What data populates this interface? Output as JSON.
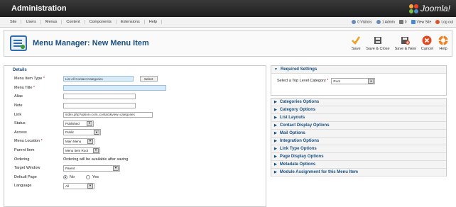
{
  "header": {
    "title": "Administration",
    "logo_text": "Joomla!"
  },
  "menu": [
    "Site",
    "Users",
    "Menus",
    "Content",
    "Components",
    "Extensions",
    "Help"
  ],
  "status": {
    "visitors": "0 Visitors",
    "admin": "1 Admin",
    "messages": "0",
    "view_site": "View Site",
    "logout": "Log out"
  },
  "page": {
    "title": "Menu Manager: New Menu Item"
  },
  "toolbar": {
    "save": "Save",
    "save_close": "Save & Close",
    "save_new": "Save & New",
    "cancel": "Cancel",
    "help": "Help"
  },
  "details": {
    "legend": "Details",
    "menu_item_type_label": "Menu Item Type",
    "menu_item_type_value": "List All Contact Categories",
    "select_button": "Select",
    "menu_title_label": "Menu Title",
    "alias_label": "Alias",
    "note_label": "Note",
    "link_label": "Link",
    "link_value": "index.php?option=com_contact&view=categories",
    "status_label": "Status",
    "status_value": "Published",
    "access_label": "Access",
    "access_value": "Public",
    "menu_location_label": "Menu Location",
    "menu_location_value": "Main Menu",
    "parent_item_label": "Parent Item",
    "parent_item_value": "Menu Item Root",
    "ordering_label": "Ordering",
    "ordering_value": "Ordering will be available after saving",
    "target_window_label": "Target Window",
    "target_window_value": "Parent",
    "default_page_label": "Default Page",
    "default_no": "No",
    "default_yes": "Yes",
    "language_label": "Language",
    "language_value": "All",
    "required_marker": "*"
  },
  "required_settings": {
    "title": "Required Settings",
    "category_label": "Select a Top Level Category",
    "category_value": "Root"
  },
  "panels": [
    "Categories Options",
    "Category Options",
    "List Layouts",
    "Contact Display Options",
    "Mail Options",
    "Integration Options",
    "Link Type Options",
    "Page Display Options",
    "Metadata Options",
    "Module Assignment for this Menu Item"
  ],
  "colors": {
    "accent": "#1b4f7e",
    "header_bg": "#2b2b2b",
    "required": "#cc0000",
    "highlight_input": "#d7ebf8"
  }
}
